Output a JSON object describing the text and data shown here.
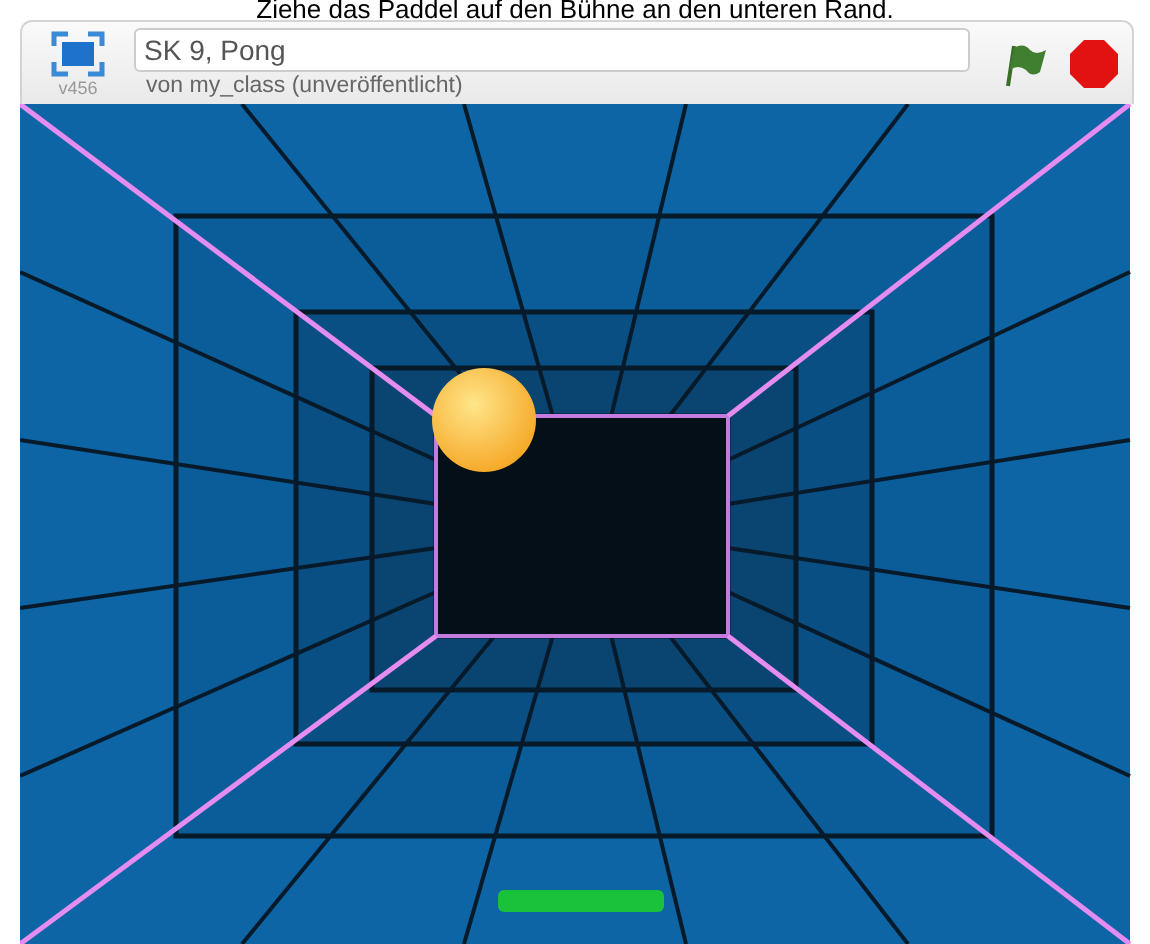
{
  "instruction": "Ziehe das Paddel auf den Bühne an den unteren Rand.",
  "header": {
    "version": "v456",
    "title": "SK 9, Pong",
    "byline": "von my_class (unveröffentlicht)"
  }
}
